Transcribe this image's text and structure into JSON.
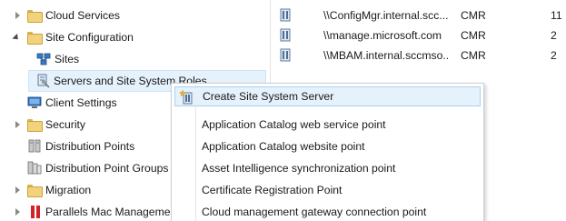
{
  "tree": {
    "items": [
      {
        "label": "Cloud Services",
        "icon": "folder-icon",
        "expander": "collapsed"
      },
      {
        "label": "Site Configuration",
        "icon": "folder-icon",
        "expander": "expanded"
      },
      {
        "label": "Sites",
        "icon": "sites-icon",
        "expander": "none"
      },
      {
        "label": "Servers and Site System Roles",
        "icon": "server-roles-icon",
        "expander": "none"
      },
      {
        "label": "Client Settings",
        "icon": "client-settings-icon",
        "expander": "none"
      },
      {
        "label": "Security",
        "icon": "folder-icon",
        "expander": "collapsed"
      },
      {
        "label": "Distribution Points",
        "icon": "distribution-points-icon",
        "expander": "none"
      },
      {
        "label": "Distribution Point Groups",
        "icon": "distribution-point-groups-icon",
        "expander": "none"
      },
      {
        "label": "Migration",
        "icon": "folder-icon",
        "expander": "collapsed"
      },
      {
        "label": "Parallels Mac Managemen",
        "icon": "parallels-icon",
        "expander": "collapsed"
      }
    ]
  },
  "server_list": {
    "rows": [
      {
        "name": "\\\\ConfigMgr.internal.scc...",
        "site_code": "CMR",
        "count": "11"
      },
      {
        "name": "\\\\manage.microsoft.com",
        "site_code": "CMR",
        "count": "2"
      },
      {
        "name": "\\\\MBAM.internal.sccmso...",
        "site_code": "CMR",
        "count": "2"
      }
    ]
  },
  "context_menu": {
    "items": [
      {
        "label": "Create Site System Server",
        "icon": "create-server-icon"
      },
      {
        "label": "Application Catalog web service point"
      },
      {
        "label": "Application Catalog website point"
      },
      {
        "label": "Asset Intelligence synchronization point"
      },
      {
        "label": "Certificate Registration Point"
      },
      {
        "label": "Cloud management gateway connection point"
      }
    ]
  },
  "colors": {
    "selection": "#e5f1fb",
    "selection_border": "#a8d2f2",
    "folder": "#f2d27a",
    "parallels_red": "#d2232a"
  }
}
